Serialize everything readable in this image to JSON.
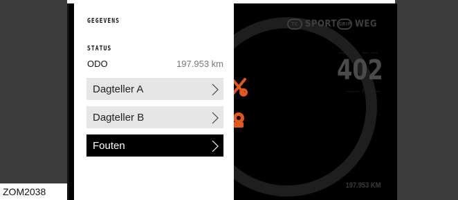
{
  "dashboard": {
    "mode_sport": "SPORT",
    "mode_sport_badge": "TC",
    "mode_road": "WEG",
    "mode_road_badge": "GRIP",
    "big_value": "402",
    "odometer": "197.953 KM",
    "warning_color": "#e2571e"
  },
  "menu": {
    "header": "GEGEVENS",
    "status_header": "STATUS",
    "odo_label": "ODO",
    "odo_value": "197.953 km",
    "items": [
      {
        "label": "Dagteller A",
        "selected": false,
        "icon": "chevron-right-icon"
      },
      {
        "label": "Dagteller B",
        "selected": false,
        "icon": "chevron-right-icon"
      },
      {
        "label": "Fouten",
        "selected": true,
        "icon": "chevron-right-icon"
      }
    ]
  },
  "caption": "ZOM2038"
}
